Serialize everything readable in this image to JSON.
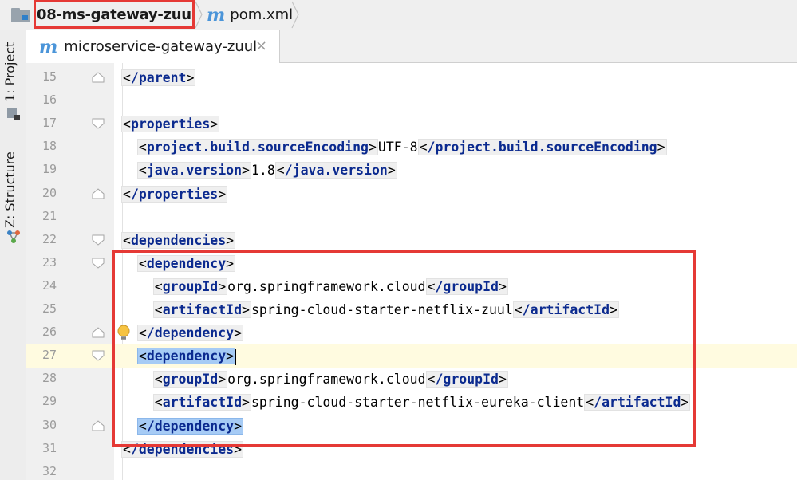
{
  "breadcrumb": {
    "module": "08-ms-gateway-zuul",
    "file": "pom.xml",
    "file_icon": "m"
  },
  "tool_windows": {
    "project": "1: Project",
    "structure": "Z: Structure"
  },
  "editor_tab": {
    "icon": "m",
    "label": "microservice-gateway-zuul",
    "close": "×"
  },
  "lines": [
    {
      "n": "15",
      "indent": "",
      "tag": "/parent",
      "content": "",
      "close": ""
    },
    {
      "n": "16",
      "indent": "",
      "tag": "",
      "content": "",
      "close": ""
    },
    {
      "n": "17",
      "indent": "",
      "tag": "properties",
      "content": "",
      "close": ""
    },
    {
      "n": "18",
      "indent": "  ",
      "tag": "project.build.sourceEncoding",
      "content": "UTF-8",
      "close": "/project.build.sourceEncoding"
    },
    {
      "n": "19",
      "indent": "  ",
      "tag": "java.version",
      "content": "1.8",
      "close": "/java.version"
    },
    {
      "n": "20",
      "indent": "",
      "tag": "/properties",
      "content": "",
      "close": ""
    },
    {
      "n": "21",
      "indent": "",
      "tag": "",
      "content": "",
      "close": ""
    },
    {
      "n": "22",
      "indent": "",
      "tag": "dependencies",
      "content": "",
      "close": ""
    },
    {
      "n": "23",
      "indent": "  ",
      "tag": "dependency",
      "content": "",
      "close": ""
    },
    {
      "n": "24",
      "indent": "    ",
      "tag": "groupId",
      "content": "org.springframework.cloud",
      "close": "/groupId"
    },
    {
      "n": "25",
      "indent": "    ",
      "tag": "artifactId",
      "content": "spring-cloud-starter-netflix-zuul",
      "close": "/artifactId"
    },
    {
      "n": "26",
      "indent": "  ",
      "tag": "/dependency",
      "content": "",
      "close": ""
    },
    {
      "n": "27",
      "indent": "  ",
      "tag": "dependency",
      "content": "",
      "close": ""
    },
    {
      "n": "28",
      "indent": "    ",
      "tag": "groupId",
      "content": "org.springframework.cloud",
      "close": "/groupId"
    },
    {
      "n": "29",
      "indent": "    ",
      "tag": "artifactId",
      "content": "spring-cloud-starter-netflix-eureka-client",
      "close": "/artifactId"
    },
    {
      "n": "30",
      "indent": "  ",
      "tag": "/dependency",
      "content": "",
      "close": ""
    },
    {
      "n": "31",
      "indent": "",
      "tag": "/dependencies",
      "content": "",
      "close": ""
    },
    {
      "n": "32",
      "indent": "",
      "tag": "",
      "content": "",
      "close": ""
    }
  ],
  "editor_state": {
    "current_line": "27",
    "highlighted_lines": [
      "27",
      "30"
    ],
    "intention_bulb_line": "26"
  },
  "colors": {
    "annotation_red": "#e53935",
    "tag_name": "#0b2a8f",
    "selection": "#a6cbf5",
    "current_line": "#fffbe0",
    "maven_icon": "#4b95d9"
  }
}
